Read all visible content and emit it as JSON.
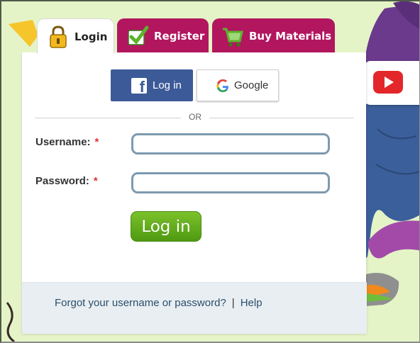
{
  "tabs": {
    "login": "Login",
    "register": "Register",
    "buy": "Buy Materials"
  },
  "social": {
    "facebook_label": "Log in",
    "google_label": "Google"
  },
  "divider": "OR",
  "form": {
    "username_label": "Username:",
    "password_label": "Password:",
    "required_marker": "*",
    "username_value": "",
    "password_value": "",
    "submit_label": "Log in"
  },
  "footer": {
    "forgot_link": "Forgot your username or password?",
    "separator": "|",
    "help_link": "Help"
  },
  "colors": {
    "tab_active_bg": "#ffffff",
    "tab_inactive_bg": "#b2165f",
    "facebook_blue": "#3d5a98",
    "login_green": "#5aa51a",
    "input_border": "#7d99ae",
    "footer_bg": "#e9eef2",
    "page_bg": "#e4f4c7"
  },
  "icons": {
    "login_tab": "padlock-icon",
    "register_tab": "checkbox-check-icon",
    "buy_tab": "shopping-cart-icon",
    "facebook": "facebook-icon",
    "google": "google-icon",
    "video": "play-icon"
  }
}
